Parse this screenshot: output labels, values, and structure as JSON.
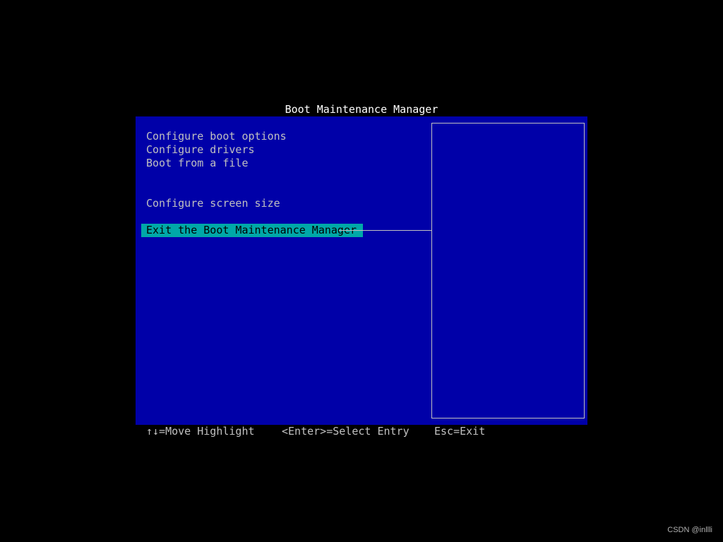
{
  "title": "Boot Maintenance Manager",
  "colors": {
    "screen_background": "#000000",
    "panel_background": "#0000a8",
    "text": "#c0c0c0",
    "title_text": "#ffffff",
    "highlight_background": "#00a8a8",
    "highlight_text": "#000000"
  },
  "menu": {
    "items": [
      {
        "label": "Configure boot options"
      },
      {
        "label": "Configure drivers"
      },
      {
        "label": "Boot from a file"
      },
      {
        "label": "Configure screen size"
      },
      {
        "label": "Exit the Boot Maintenance Manager",
        "selected": true
      }
    ]
  },
  "help_panel": {
    "text": ""
  },
  "footer": {
    "move": "↑↓=Move Highlight",
    "select": "<Enter>=Select Entry",
    "exit": "Esc=Exit"
  },
  "watermark": "CSDN @inllli"
}
